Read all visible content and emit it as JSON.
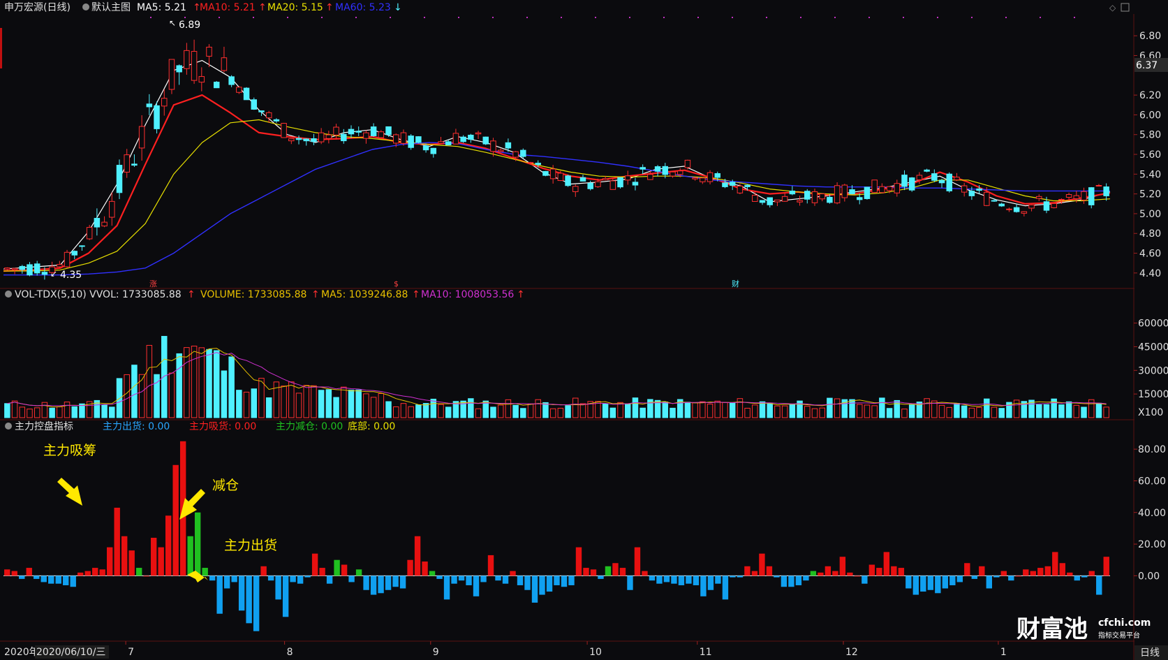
{
  "header": {
    "stock_title": "申万宏源(日线)",
    "main_chart_label": "默认主图",
    "ma5": "MA5: 5.21",
    "ma10": "MA10: 5.21",
    "ma20": "MA20: 5.15",
    "ma60": "MA60: 5.23"
  },
  "volume_header": {
    "title": "VOL-TDX(5,10) VVOL: 1733085.88",
    "volume": "VOLUME: 1733085.88",
    "ma5": "MA5: 1039246.88",
    "ma10": "MA10: 1008053.56"
  },
  "indicator_header": {
    "title": "主力控盘指标",
    "out": "主力出货: 0.00",
    "absorb": "主力吸货: 0.00",
    "reduce": "主力减仓: 0.00",
    "bottom": "底部: 0.00"
  },
  "annotations": {
    "absorb": "主力吸筹",
    "reduce": "减仓",
    "out": "主力出货"
  },
  "bottom_bar": {
    "date": "2020/06/10/三",
    "date_prefix": "2020年",
    "period": "日线"
  },
  "watermark": {
    "brand": "财富池",
    "site": "cfchi.com",
    "slogan": "指标交易平台"
  },
  "markers": {
    "zhang": "涨",
    "dollar": "$",
    "cai": "财"
  },
  "colors": {
    "up": "#ff2f2f",
    "down": "#4ff0ff",
    "ma5": "#ffffff",
    "ma10": "#ff2020",
    "ma20": "#e8e000",
    "ma60": "#3030ff",
    "vol_ma5": "#e8c000",
    "vol_ma10": "#d030d0",
    "ind_up": "#e81010",
    "ind_green": "#20c020",
    "ind_down": "#10a0f0"
  },
  "chart_data": [
    {
      "type": "candlestick",
      "title": "申万宏源(日线)",
      "ylim": [
        4.3,
        6.95
      ],
      "y_ticks": [
        "6.80",
        "6.60",
        "6.37",
        "6.20",
        "6.00",
        "5.80",
        "5.60",
        "5.40",
        "5.20",
        "5.00",
        "4.80",
        "4.60",
        "4.40"
      ],
      "x_tick_labels": [
        "7",
        "8",
        "9",
        "10",
        "11",
        "12",
        "1"
      ],
      "current_price": "6.37",
      "high_label": "6.89",
      "low_label": "4.35",
      "series": [
        {
          "name": "MA5",
          "values": [
            4.44,
            4.46,
            4.48,
            4.82,
            5.3,
            5.9,
            6.45,
            6.55,
            6.38,
            6.05,
            5.8,
            5.72,
            5.82,
            5.85,
            5.75,
            5.68,
            5.78,
            5.72,
            5.62,
            5.42,
            5.3,
            5.32,
            5.35,
            5.45,
            5.48,
            5.35,
            5.28,
            5.12,
            5.15,
            5.18,
            5.22,
            5.26,
            5.32,
            5.38,
            5.24,
            5.14,
            5.08,
            5.1,
            5.14,
            5.22
          ]
        },
        {
          "name": "MA10",
          "values": [
            4.42,
            4.43,
            4.45,
            4.6,
            4.88,
            5.5,
            6.1,
            6.2,
            6.02,
            5.82,
            5.78,
            5.75,
            5.76,
            5.78,
            5.72,
            5.7,
            5.72,
            5.66,
            5.56,
            5.46,
            5.38,
            5.34,
            5.38,
            5.41,
            5.44,
            5.36,
            5.25,
            5.2,
            5.22,
            5.19,
            5.2,
            5.25,
            5.3,
            5.42,
            5.32,
            5.18,
            5.1,
            5.11,
            5.16,
            5.21
          ]
        },
        {
          "name": "MA20",
          "values": [
            4.42,
            4.42,
            4.43,
            4.5,
            4.62,
            4.9,
            5.4,
            5.72,
            5.92,
            5.95,
            5.88,
            5.82,
            5.78,
            5.76,
            5.73,
            5.7,
            5.68,
            5.62,
            5.55,
            5.48,
            5.42,
            5.38,
            5.37,
            5.38,
            5.38,
            5.36,
            5.31,
            5.25,
            5.22,
            5.2,
            5.19,
            5.21,
            5.26,
            5.34,
            5.34,
            5.26,
            5.18,
            5.13,
            5.13,
            5.15
          ]
        },
        {
          "name": "MA60",
          "values": [
            4.38,
            4.38,
            4.38,
            4.39,
            4.41,
            4.45,
            4.6,
            4.8,
            5.0,
            5.15,
            5.3,
            5.45,
            5.55,
            5.65,
            5.7,
            5.72,
            5.71,
            5.65,
            5.6,
            5.58,
            5.55,
            5.52,
            5.48,
            5.43,
            5.38,
            5.34,
            5.32,
            5.3,
            5.28,
            5.27,
            5.27,
            5.27,
            5.26,
            5.26,
            5.25,
            5.24,
            5.23,
            5.23,
            5.23,
            5.23
          ]
        }
      ]
    },
    {
      "type": "bar",
      "title": "VOL-TDX(5,10)",
      "ylim": [
        0,
        70000
      ],
      "y_ticks": [
        "60000",
        "45000",
        "30000",
        "15000"
      ],
      "y_unit": "X100"
    },
    {
      "type": "bar",
      "title": "主力控盘指标",
      "ylim": [
        -40,
        88
      ],
      "y_ticks": [
        "80.00",
        "60.00",
        "40.00",
        "20.00",
        "0.00"
      ],
      "values": [
        4,
        3,
        -2,
        5,
        -2,
        -4,
        -5,
        -5,
        -6,
        -7,
        2,
        3,
        5,
        4,
        18,
        43,
        25,
        16,
        5,
        0,
        24,
        18,
        38,
        70,
        85,
        25,
        40,
        5,
        -3,
        -24,
        -8,
        -4,
        -22,
        -30,
        -35,
        6,
        -3,
        -15,
        -26,
        -4,
        -5,
        -1,
        14,
        5,
        -5,
        10,
        7,
        -4,
        4,
        -9,
        -12,
        -11,
        -9,
        -7,
        -8,
        10,
        25,
        9,
        3,
        -2,
        -15,
        -5,
        -3,
        -6,
        -13,
        -4,
        13,
        -3,
        -5,
        3,
        -6,
        -9,
        -17,
        -12,
        -10,
        -6,
        -7,
        -6,
        18,
        5,
        4,
        -2,
        6,
        8,
        5,
        -9,
        18,
        3,
        -3,
        -5,
        -4,
        -5,
        -6,
        -5,
        -6,
        -13,
        -9,
        -5,
        -15,
        -1,
        -1,
        6,
        3,
        14,
        6,
        -1,
        -7,
        -7,
        -6,
        -3,
        3,
        2,
        6,
        3,
        12,
        2,
        0,
        -5,
        7,
        5,
        15,
        6,
        5,
        -8,
        -12,
        -10,
        -9,
        -11,
        -8,
        -6,
        -4,
        8,
        -2,
        6,
        -8,
        -1,
        3,
        -3,
        0,
        4,
        3,
        5,
        6,
        15,
        8,
        2,
        -3,
        -1,
        3,
        -12,
        12
      ]
    }
  ]
}
